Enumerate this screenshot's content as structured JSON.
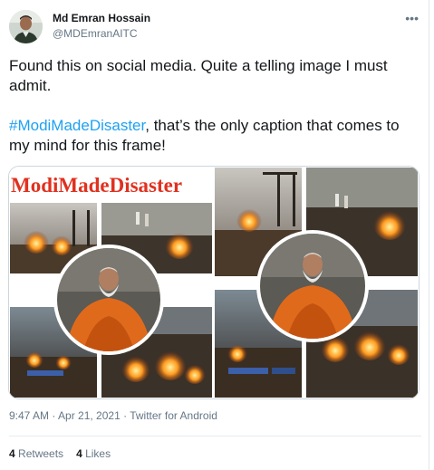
{
  "tweet": {
    "author": {
      "display_name": "Md Emran Hossain",
      "handle": "@MDEmranAITC"
    },
    "more_icon": "•••",
    "text_line1": "Found this on social media. Quite a telling image I must admit.",
    "hashtag": "#ModiMadeDisaster",
    "text_line2_rest": ", that’s the only caption that comes to my mind for this frame!",
    "media": {
      "banner_text": "ModiMadeDisaster",
      "banner_color": "#e0311f"
    },
    "timestamp": "9:47 AM · Apr 21, 2021 · Twitter for Android",
    "retweets": {
      "count": "4",
      "label": "Retweets"
    },
    "likes": {
      "count": "4",
      "label": "Likes"
    }
  },
  "colors": {
    "link": "#1da1f2",
    "secondary_text": "#657786",
    "primary_text": "#14171a",
    "border": "#e6ecf0"
  }
}
